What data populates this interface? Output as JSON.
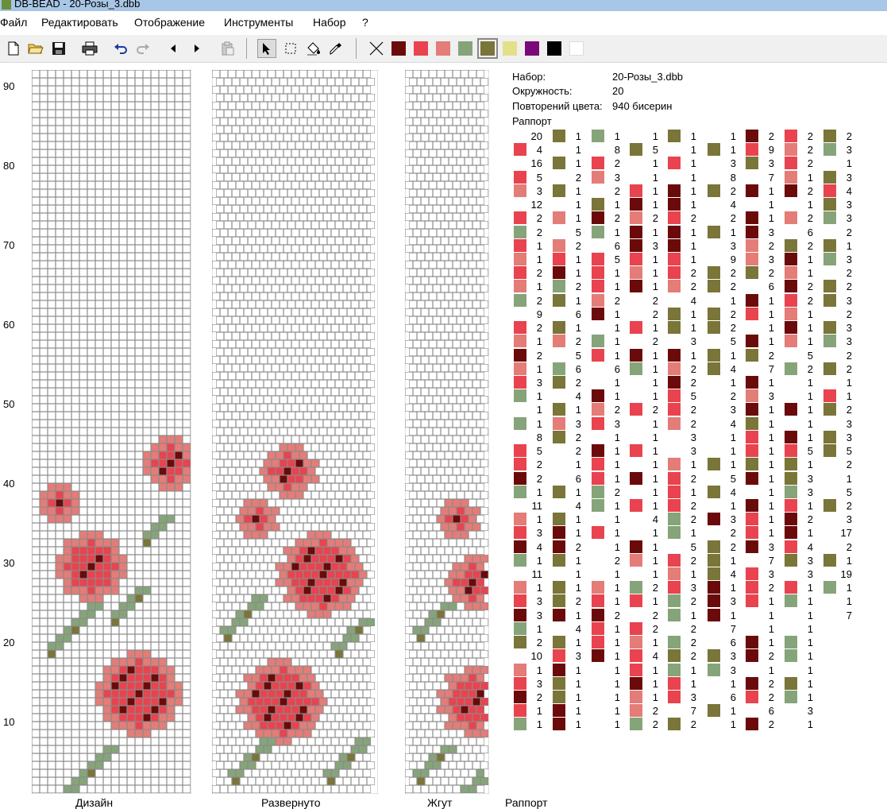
{
  "window": {
    "title": "DB-BEAD - 20-Розы_3.dbb"
  },
  "menu": [
    "Файл",
    "Редактировать",
    "Отображение",
    "Инструменты",
    "Набор",
    "?"
  ],
  "toolbar": {
    "icons": [
      "new-file-icon",
      "open-folder-icon",
      "save-icon",
      "print-icon",
      "undo-icon",
      "redo-icon",
      "arrow-left-icon",
      "arrow-right-icon",
      "paste-icon",
      "pointer-tool-icon",
      "select-rect-tool-icon",
      "fill-bucket-tool-icon",
      "eyedropper-tool-icon",
      "clear-color-icon"
    ]
  },
  "palette": [
    "#6b0a0a",
    "#e8434f",
    "#e47c78",
    "#86a47a",
    "#7a7538",
    "#e3e08a",
    "#7b0a78",
    "#000000",
    "#ffffff"
  ],
  "selected_palette_index": 4,
  "ruler": [
    "90",
    "80",
    "70",
    "60",
    "50",
    "40",
    "30",
    "20",
    "10"
  ],
  "panels": {
    "design": "Дизайн",
    "unrolled": "Развернуто",
    "rope": "Жгут",
    "repeat": "Раппорт"
  },
  "info": {
    "set_label": "Набор:",
    "set_value": "20-Розы_3.dbb",
    "circ_label": "Окружность:",
    "circ_value": "20",
    "rep_label": "Повторений цвета:",
    "rep_value": "940 бисерин",
    "repeat_label": "Раппорт"
  },
  "legend_colors": {
    "W": "#ffffff",
    "D": "#6b0a0a",
    "R": "#e8434f",
    "P": "#e47c78",
    "G": "#86a47a",
    "O": "#7a7538"
  },
  "legend": [
    [
      "W20",
      "R4",
      "W16",
      "R5",
      "P3",
      "W12",
      "R2",
      "G2",
      "R1",
      "P1",
      "R2",
      "P1",
      "G2",
      "W9",
      "R2",
      "P1",
      "D2",
      "P1",
      "R3",
      "G1",
      "W1",
      "G1",
      "W8",
      "R5",
      "R2",
      "D2",
      "G1",
      "W11",
      "P1",
      "R3",
      "D4",
      "G1",
      "W11",
      "P1",
      "R3",
      "D3",
      "G1",
      "O2",
      "W10",
      "P1",
      "R3",
      "D2",
      "R1",
      "G1"
    ],
    [
      "O1",
      "W1",
      "O1",
      "W2",
      "O1",
      "W1",
      "P1",
      "W5",
      "P2",
      "R1",
      "D1",
      "G2",
      "O1",
      "W6",
      "O1",
      "P2",
      "W5",
      "G6",
      "O2",
      "W4",
      "O1",
      "P3",
      "O2",
      "W2",
      "W1",
      "W6",
      "O1",
      "W4",
      "O1",
      "D1",
      "D2",
      "O1",
      "W1",
      "O1",
      "O2",
      "D1",
      "W4",
      "O1",
      "R3",
      "D1",
      "O1",
      "O1",
      "D1",
      "D1"
    ],
    [
      "G1",
      "W8",
      "R2",
      "P3",
      "W2",
      "O1",
      "D2",
      "G1",
      "W6",
      "R5",
      "R1",
      "R1",
      "P2",
      "D1",
      "W1",
      "G1",
      "R1",
      "W6",
      "W1",
      "D1",
      "P2",
      "R3",
      "W1",
      "D1",
      "R1",
      "R1",
      "G2",
      "G1",
      "W1",
      "R1",
      "W1",
      "W2",
      "W1",
      "P1",
      "R1",
      "D2",
      "R1",
      "R1",
      "D1",
      "W1",
      "W1",
      "W1",
      "W1",
      "W1"
    ],
    [
      "W1",
      "O5",
      "W1",
      "W1",
      "R1",
      "D1",
      "P2",
      "D1",
      "D3",
      "R1",
      "P1",
      "D1",
      "W2",
      "W2",
      "R1",
      "W2",
      "D1",
      "G1",
      "W1",
      "W1",
      "R2",
      "W1",
      "W1",
      "R1",
      "W1",
      "D1",
      "W1",
      "R1",
      "W4",
      "W1",
      "D1",
      "P1",
      "W1",
      "G2",
      "R1",
      "W2",
      "R2",
      "P1",
      "R4",
      "R1",
      "D1",
      "P1",
      "P2",
      "G2"
    ],
    [
      "O1",
      "W1",
      "R1",
      "W1",
      "D1",
      "D1",
      "R2",
      "D1",
      "D1",
      "R1",
      "R2",
      "P2",
      "W4",
      "O1",
      "O1",
      "W3",
      "D1",
      "P2",
      "D2",
      "R5",
      "R2",
      "P2",
      "W3",
      "W3",
      "P1",
      "R2",
      "R1",
      "R2",
      "G2",
      "G1",
      "W5",
      "R2",
      "P1",
      "R3",
      "G2",
      "G1",
      "W2",
      "G2",
      "O2",
      "G1",
      "R1",
      "R3",
      "W7",
      "O2"
    ],
    [
      "W1",
      "O1",
      "W3",
      "W8",
      "O2",
      "W4",
      "W2",
      "O1",
      "W3",
      "W9",
      "O2",
      "O2",
      "W1",
      "O2",
      "O2",
      "W5",
      "O1",
      "O4",
      "W1",
      "W2",
      "W3",
      "W4",
      "W1",
      "W1",
      "O1",
      "W5",
      "O4",
      "W1",
      "D3",
      "W2",
      "O2",
      "O1",
      "O4",
      "D1",
      "D3",
      "D1",
      "W7",
      "W6",
      "O3",
      "G3",
      "W1",
      "W6",
      "O1",
      "W1"
    ],
    [
      "D2",
      "R9",
      "O3",
      "W7",
      "D1",
      "W1",
      "D1",
      "D3",
      "P2",
      "P3",
      "O2",
      "W6",
      "D1",
      "R1",
      "W1",
      "D1",
      "O2",
      "W7",
      "D1",
      "P3",
      "D1",
      "O1",
      "R1",
      "R1",
      "O1",
      "D1",
      "W1",
      "D1",
      "R1",
      "R1",
      "D3",
      "W7",
      "R3",
      "R2",
      "R1",
      "W1",
      "W1",
      "D1",
      "D2",
      "W1",
      "D2",
      "R2",
      "W6",
      "D2"
    ],
    [
      "R2",
      "P2",
      "R2",
      "P1",
      "D2",
      "W1",
      "P2",
      "W6",
      "O2",
      "D1",
      "P1",
      "D2",
      "R2",
      "P1",
      "D1",
      "P1",
      "W5",
      "G2",
      "W1",
      "W1",
      "D1",
      "W1",
      "D1",
      "R5",
      "O1",
      "O3",
      "G3",
      "R1",
      "D2",
      "D1",
      "R4",
      "O3",
      "W3",
      "R1",
      "G1",
      "W1",
      "W1",
      "G1",
      "G1",
      "W1",
      "O1",
      "G1",
      "W3",
      "W1"
    ],
    [
      "O2",
      "G3",
      "W1",
      "O3",
      "R4",
      "O3",
      "G3",
      "W2",
      "O1",
      "G3",
      "W2",
      "O2",
      "O3",
      "W2",
      "O3",
      "G3",
      "W2",
      "O2",
      "W1",
      "R1",
      "O2",
      "W3",
      "O3",
      "O5",
      "W2",
      "W1",
      "W5",
      "O2",
      "W3",
      "W17",
      "W2",
      "O1",
      "W19",
      "G1",
      "W1",
      "W7"
    ]
  ]
}
